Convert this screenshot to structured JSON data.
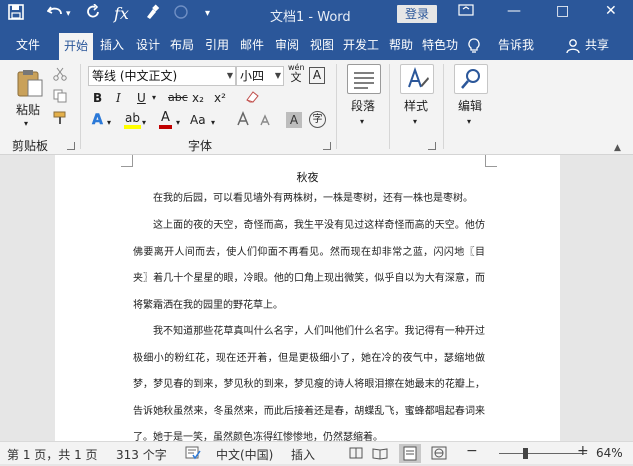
{
  "titlebar": {
    "title": "文档1 - Word",
    "login_label": "登录",
    "minimize": "—",
    "restore": "□",
    "close": "✕",
    "colors": {
      "bar": "#2b579a"
    }
  },
  "quick_access": {
    "save_icon": "save-icon",
    "undo_icon": "undo-icon",
    "redo_icon": "redo-icon",
    "formula_icon": "formula-icon",
    "brush_icon": "touch-mode-icon",
    "customize_icon": "chevron-down-icon"
  },
  "tabs": [
    {
      "label": "文件"
    },
    {
      "label": "开始"
    },
    {
      "label": "插入"
    },
    {
      "label": "设计"
    },
    {
      "label": "布局"
    },
    {
      "label": "引用"
    },
    {
      "label": "邮件"
    },
    {
      "label": "审阅"
    },
    {
      "label": "视图"
    },
    {
      "label": "开发工"
    },
    {
      "label": "帮助"
    },
    {
      "label": "特色功"
    }
  ],
  "tell_me": "告诉我",
  "share": "共享",
  "ribbon": {
    "clipboard": {
      "paste": "粘贴",
      "group": "剪贴板"
    },
    "font": {
      "font_name": "等线 (中文正文)",
      "font_size": "小四",
      "wen": "wén",
      "wen_char": "文",
      "A_box": "A",
      "bold": "B",
      "italic": "I",
      "underline": "U",
      "strike": "abc",
      "sub": "x₂",
      "sup": "x²",
      "text_effects": "A",
      "highlight": "ab",
      "font_color": "A",
      "change_case": "Aa",
      "char_shade": "A",
      "enclose": "字",
      "group": "字体"
    },
    "paragraph": {
      "label": "段落"
    },
    "styles": {
      "label": "样式"
    },
    "editing": {
      "label": "编辑"
    }
  },
  "document": {
    "heading": "秋夜",
    "paragraphs": [
      "在我的后园，可以看见墙外有两株树，一株是枣树，还有一株也是枣树。",
      "这上面的夜的天空，奇怪而高，我生平没有见过这样奇怪而高的天空。他仿佛要离开人间而去，使人们仰面不再看见。然而现在却非常之蓝，闪闪地〖目夹〗着几十个星星的眼，冷眼。他的口角上现出微笑，似乎自以为大有深意，而将繁霜洒在我的园里的野花草上。",
      "我不知道那些花草真叫什么名字，人们叫他们什么名字。我记得有一种开过极细小的粉红花，现在还开着，但是更极细小了，她在冷的夜气中，瑟缩地做梦，梦见春的到来，梦见秋的到来，梦见瘦的诗人将眼泪擦在她最末的花瓣上，告诉她秋虽然来，冬虽然来，而此后接着还是春，胡蝶乱飞，蜜蜂都唱起春词来了。她于是一笑，虽然颜色冻得红惨惨地，仍然瑟缩着。"
    ]
  },
  "status": {
    "page": "第 1 页，共 1 页",
    "words": "313 个字",
    "lang": "中文(中国)",
    "mode": "插入",
    "zoom_minus": "−",
    "zoom_plus": "+",
    "zoom": "64%",
    "zoom_level": 0.64
  }
}
